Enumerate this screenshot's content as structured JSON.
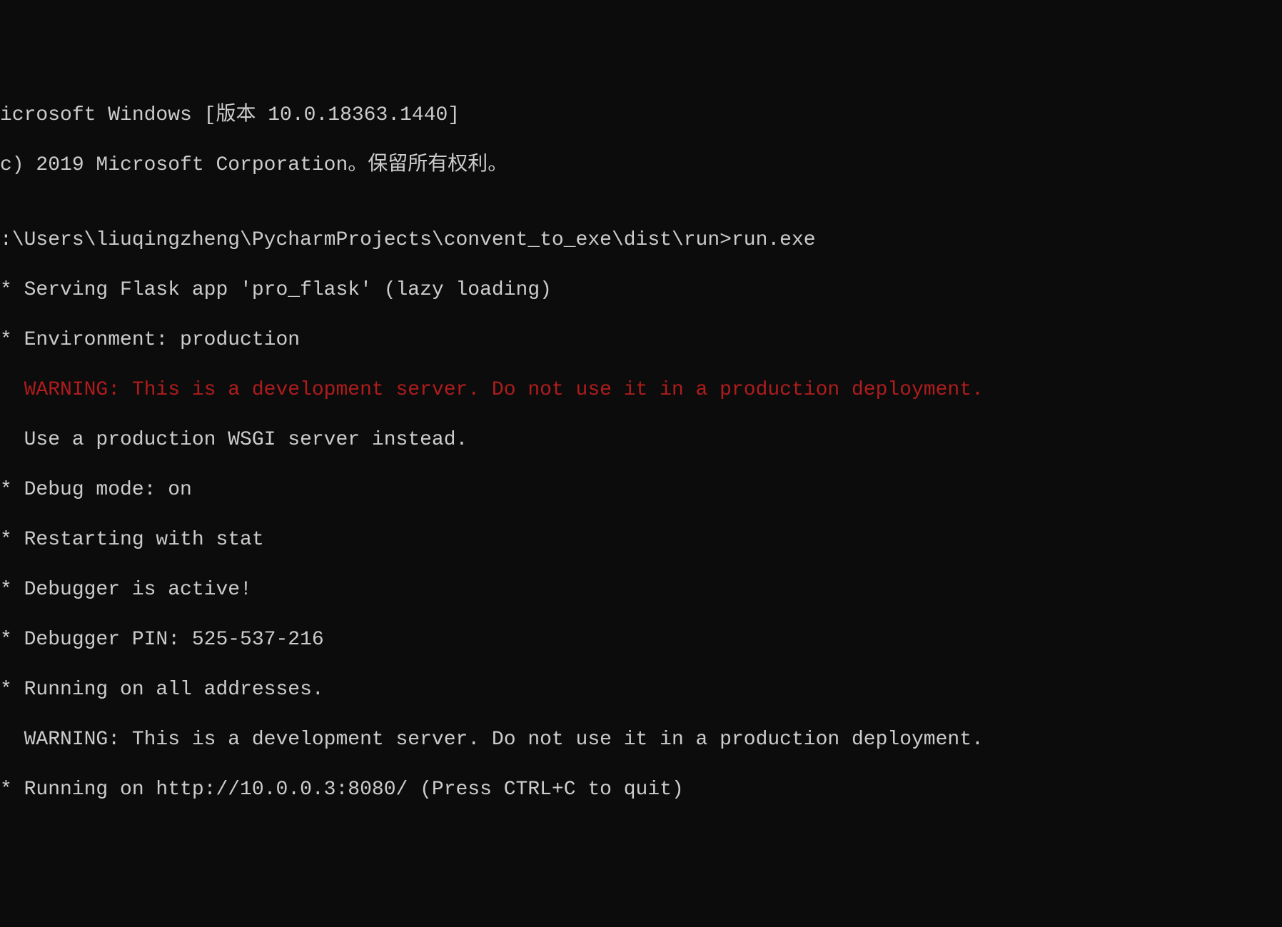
{
  "terminal": {
    "lines": {
      "version": "icrosoft Windows [版本 10.0.18363.1440]",
      "copyright": "c) 2019 Microsoft Corporation。保留所有权利。",
      "blank1": "",
      "prompt": ":\\Users\\liuqingzheng\\PycharmProjects\\convent_to_exe\\dist\\run>run.exe",
      "serving": "* Serving Flask app 'pro_flask' (lazy loading)",
      "environment": "* Environment: production",
      "warning_red": "  WARNING: This is a development server. Do not use it in a production deployment.",
      "use_wsgi": "  Use a production WSGI server instead.",
      "debug_mode": "* Debug mode: on",
      "restarting": "* Restarting with stat",
      "debugger_active": "* Debugger is active!",
      "debugger_pin": "* Debugger PIN: 525-537-216",
      "running_all": "* Running on all addresses.",
      "warning_white": "  WARNING: This is a development server. Do not use it in a production deployment.",
      "running_on": "* Running on http://10.0.0.3:8080/ (Press CTRL+C to quit)"
    }
  }
}
